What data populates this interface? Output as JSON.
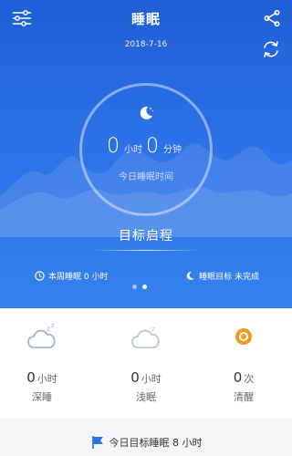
{
  "header": {
    "title": "睡眠",
    "date": "2018-7-16",
    "settings_icon": "sliders-icon",
    "share_icon": "share-icon",
    "sync_icon": "sync-icon"
  },
  "ring": {
    "hours_value": "0",
    "hours_unit": "小时",
    "minutes_value": "0",
    "minutes_unit": "分钟",
    "caption": "今日睡眠时间"
  },
  "goal": {
    "title": "目标启程"
  },
  "summary": {
    "week_label": "本周睡眠 0 小时",
    "target_label": "睡眠目标 未完成"
  },
  "pager": {
    "count": 2,
    "active": 1
  },
  "stats": [
    {
      "value": "0",
      "unit": "小时",
      "label": "深睡",
      "icon": "deep-sleep-cloud-icon"
    },
    {
      "value": "0",
      "unit": "小时",
      "label": "浅眠",
      "icon": "light-sleep-cloud-icon"
    },
    {
      "value": "0",
      "unit": "次",
      "label": "清醒",
      "icon": "awake-sun-icon"
    }
  ],
  "bottom": {
    "goal_text": "今日目标睡眠 8 小时"
  },
  "colors": {
    "hero_blue": "#2c71e6",
    "awake_orange": "#f29a1f",
    "icon_blue": "#9fb3d6"
  }
}
